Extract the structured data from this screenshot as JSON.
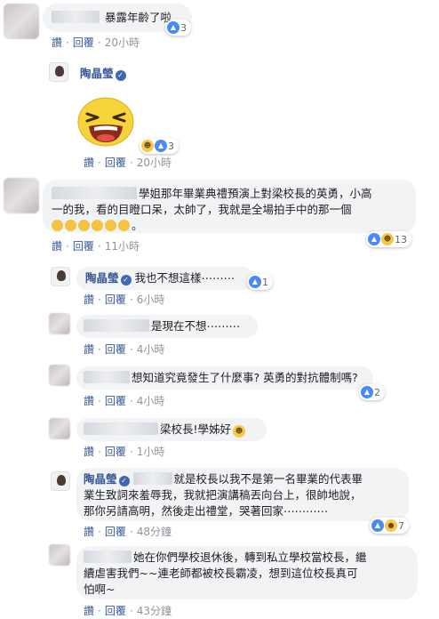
{
  "comments": [
    {
      "id": "c1",
      "text": "暴露年齡了啦",
      "reactions": {
        "count": "3"
      },
      "actions": {
        "like": "讚",
        "reply": "回覆",
        "time": "20小時"
      }
    },
    {
      "id": "c2",
      "author": "陶晶瑩",
      "reactions": {
        "count": "3"
      },
      "actions": {
        "like": "讚",
        "reply": "回覆",
        "time": "20小時"
      }
    },
    {
      "id": "c3",
      "text_line1": "學姐那年畢業典禮預演上對梁校長的英勇，小高",
      "text_line2": "一的我，看的目瞪口呆，太帥了，我就是全場拍手中的那一個",
      "text_suffix": "。",
      "reactions": {
        "count": "13"
      },
      "actions": {
        "like": "讚",
        "reply": "回覆",
        "time": "11小時"
      }
    },
    {
      "id": "c4",
      "author": "陶晶瑩",
      "text": "我也不想這樣⋯⋯⋯",
      "reactions": {
        "count": "1"
      },
      "actions": {
        "like": "讚",
        "reply": "回覆",
        "time": "6小時"
      }
    },
    {
      "id": "c5",
      "text": "是現在不想⋯⋯⋯",
      "actions": {
        "like": "讚",
        "reply": "回覆",
        "time": "4小時"
      }
    },
    {
      "id": "c6",
      "text": "想知道究竟發生了什麼事? 英勇的對抗體制嗎?",
      "reactions": {
        "count": "2"
      },
      "actions": {
        "like": "讚",
        "reply": "回覆",
        "time": "4小時"
      }
    },
    {
      "id": "c7",
      "text": "梁校長!學姊好",
      "actions": {
        "like": "讚",
        "reply": "回覆",
        "time": "1小時"
      }
    },
    {
      "id": "c8",
      "author": "陶晶瑩",
      "text_line1": "就是校長以我不是第一名畢業的代表畢",
      "text_line2": "業生致詞來羞辱我，我就把演講稿丟向台上，很帥地說，",
      "text_line3": "那你另請高明，然後走出禮堂，哭著回家⋯⋯⋯⋯",
      "reactions": {
        "count": "7"
      },
      "actions": {
        "like": "讚",
        "reply": "回覆",
        "time": "48分鐘"
      }
    },
    {
      "id": "c9",
      "text_line1": "她在你們學校退休後，轉到私立學校當校長，繼",
      "text_line2": "續虐害我們~~連老師都被校長霸凌，想到這位校長真可",
      "text_line3": "怕啊~",
      "actions": {
        "like": "讚",
        "reply": "回覆",
        "time": "43分鐘"
      }
    }
  ],
  "icons": {
    "like": "thumbs-up-icon",
    "haha": "laughing-face-icon",
    "wow": "wow-face-icon",
    "verified": "verified-check-icon",
    "clap": "clapping-hands-icon"
  },
  "colors": {
    "link": "#385898",
    "meta": "#90949c",
    "bubble": "#f2f3f5",
    "verified": "#4267b2"
  }
}
